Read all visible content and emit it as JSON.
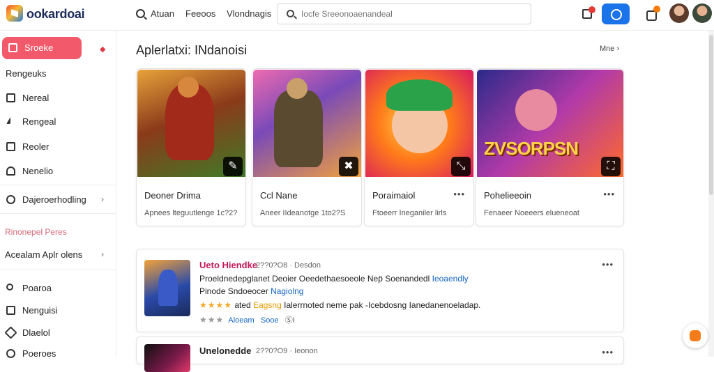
{
  "topbar": {
    "brand": "ookardoai",
    "nav": [
      "Atuan",
      "Feeoos",
      "Vlondnagis"
    ],
    "search_placeholder": "Iocfe Sreeonoaenandeal"
  },
  "sidebar": {
    "items": [
      {
        "label": "Sroeke",
        "icon": "home-icon"
      },
      {
        "label": "Rengeuks",
        "icon": "grid-icon"
      },
      {
        "label": "Nereal",
        "icon": "folder-icon"
      },
      {
        "label": "Rengeal",
        "icon": "share-icon"
      },
      {
        "label": "Reoler",
        "icon": "image-icon"
      },
      {
        "label": "Nenelio",
        "icon": "bell-icon"
      },
      {
        "label": "Dajeroerhodling",
        "icon": "search-icon"
      }
    ],
    "section_title": "Rinonepel Peres",
    "section_item": "Acealam Aplr olens",
    "bottom_items": [
      {
        "label": "Poaroa",
        "icon": "user-icon"
      },
      {
        "label": "Nenguisi",
        "icon": "box-icon"
      },
      {
        "label": "Dlaelol",
        "icon": "tag-icon"
      },
      {
        "label": "Poeroes",
        "icon": "gear-icon"
      }
    ]
  },
  "main": {
    "section_title": "Aplerlatxi: INdanoisi",
    "more_label": "Mne",
    "cards": [
      {
        "title": "Deoner Drima",
        "subtitle": "Apnees lteguutlenge 1c?2?",
        "badge": "✎"
      },
      {
        "title": "Ccl Nane",
        "subtitle": "Aneer IIdeanotge 1to2?S",
        "badge": "✖"
      },
      {
        "title": "Poraimaiol",
        "subtitle": "Ftoeerr Ineganiler lirls",
        "badge": "⤡"
      },
      {
        "title": "Pohelieeoin",
        "subtitle": "Fenaeer Noeeers elueneoat",
        "badge": "⛶"
      }
    ],
    "art_text": "ZVSORPSN"
  },
  "list": [
    {
      "title": "Ueto Hiendke",
      "meta": "2??0?O8 · Desdon",
      "line1": "Proeldnedepglanet  Deoier  Oeedethaesoeole  Nep̈  Soenandedl",
      "line1_link": "Ieoaendly",
      "line2": "Pinode Sndoeocer",
      "line2_link": "Nagiolng",
      "stars": "★★★★",
      "line3_a": "ated",
      "line3_b": "Eagsng",
      "line3_c": "Ialerrnoted neme pak -Icebdosng Ianedanenoeladap.",
      "foot_stars": "★★★",
      "foot_a": "Aloeam",
      "foot_b": "Sooe",
      "foot_c": "ⓈI"
    },
    {
      "title": "Unelonedde",
      "meta": "2??0?O9 · Ieonon"
    }
  ]
}
